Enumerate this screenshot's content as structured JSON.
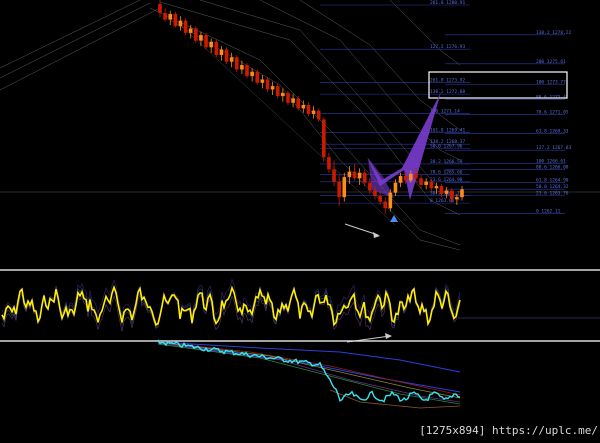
{
  "watermark": "[1275x894] https://uplc.me/",
  "colors": {
    "background": "#000000",
    "bull_candle": "#ff8c1a",
    "bear_candle": "#cc1a00",
    "fib_line": "#2b3aa8",
    "fib_text": "#5a6fd8",
    "envelope": "#8f8f8f",
    "pattern_fill": "#7a3ccf",
    "oscillator": "#ffee00",
    "divider": "#d9d9d9",
    "cyan_line": "#33e6f2",
    "arrow": "#4d8cff"
  },
  "chart_data": {
    "type": "line",
    "title": "",
    "price_range": [
      1261,
      1281
    ],
    "fib_levels": [
      {
        "label": "261.8 1280.91",
        "price": 1280.91
      },
      {
        "label": "138.2 1278.22",
        "price": 1278.22
      },
      {
        "label": "127.2 1276.93",
        "price": 1276.93
      },
      {
        "label": "200 1275.61",
        "price": 1275.61
      },
      {
        "label": "261.8 1273.92",
        "price": 1273.92
      },
      {
        "label": "100 1273.77",
        "price": 1273.77
      },
      {
        "label": "138.2 1272.88",
        "price": 1272.88
      },
      {
        "label": "88.6 1272.41",
        "price": 1272.41
      },
      {
        "label": "100 1271.14",
        "price": 1271.14
      },
      {
        "label": "78.6 1271.05",
        "price": 1271.05
      },
      {
        "label": "161.8 1269.41",
        "price": 1269.41
      },
      {
        "label": "61.8 1269.33",
        "price": 1269.33
      },
      {
        "label": "138.2 1268.37",
        "price": 1268.37
      },
      {
        "label": "127.2 1267.83",
        "price": 1267.83
      },
      {
        "label": "50.0 1267.96",
        "price": 1267.96
      },
      {
        "label": "100 1266.61",
        "price": 1266.61
      },
      {
        "label": "38.2 1266.59",
        "price": 1266.59
      },
      {
        "label": "88.6 1266.08",
        "price": 1266.08
      },
      {
        "label": "78.6 1265.66",
        "price": 1265.66
      },
      {
        "label": "61.8 1264.90",
        "price": 1264.9
      },
      {
        "label": "23.6 1264.98",
        "price": 1264.98
      },
      {
        "label": "50.0 1264.32",
        "price": 1264.32
      },
      {
        "label": "38.2 1263.74",
        "price": 1263.74
      },
      {
        "label": "23.6 1263.76",
        "price": 1263.76
      },
      {
        "label": "0 1263.06",
        "price": 1263.06
      },
      {
        "label": "0 1262.11",
        "price": 1262.11
      }
    ],
    "candles": [
      [
        1281.0,
        1281.5,
        1279.8,
        1280.2
      ],
      [
        1280.2,
        1280.6,
        1279.4,
        1279.6
      ],
      [
        1279.6,
        1280.4,
        1279.1,
        1280.1
      ],
      [
        1280.1,
        1280.3,
        1278.9,
        1279.0
      ],
      [
        1279.0,
        1279.9,
        1278.6,
        1279.5
      ],
      [
        1279.5,
        1279.7,
        1278.2,
        1278.4
      ],
      [
        1278.4,
        1279.1,
        1277.9,
        1278.8
      ],
      [
        1278.8,
        1279.0,
        1277.5,
        1277.7
      ],
      [
        1277.7,
        1278.5,
        1277.2,
        1278.2
      ],
      [
        1278.2,
        1278.4,
        1276.9,
        1277.1
      ],
      [
        1277.1,
        1277.9,
        1276.6,
        1277.6
      ],
      [
        1277.6,
        1277.8,
        1276.2,
        1276.4
      ],
      [
        1276.4,
        1277.2,
        1275.9,
        1276.9
      ],
      [
        1276.9,
        1277.1,
        1275.6,
        1275.8
      ],
      [
        1275.8,
        1276.6,
        1275.3,
        1276.2
      ],
      [
        1276.2,
        1276.4,
        1274.9,
        1275.1
      ],
      [
        1275.1,
        1275.9,
        1274.7,
        1275.5
      ],
      [
        1275.5,
        1275.7,
        1274.3,
        1274.5
      ],
      [
        1274.5,
        1275.2,
        1274.0,
        1274.9
      ],
      [
        1274.9,
        1275.1,
        1273.7,
        1273.9
      ],
      [
        1273.9,
        1274.6,
        1273.4,
        1274.2
      ],
      [
        1274.2,
        1274.4,
        1273.1,
        1273.3
      ],
      [
        1273.3,
        1274.0,
        1272.8,
        1273.6
      ],
      [
        1273.6,
        1273.8,
        1272.5,
        1272.7
      ],
      [
        1272.7,
        1273.4,
        1272.2,
        1273.0
      ],
      [
        1273.0,
        1273.2,
        1271.9,
        1272.1
      ],
      [
        1272.1,
        1272.9,
        1271.7,
        1272.5
      ],
      [
        1272.5,
        1272.7,
        1271.4,
        1271.6
      ],
      [
        1271.6,
        1272.3,
        1271.2,
        1271.9
      ],
      [
        1271.9,
        1272.1,
        1270.9,
        1271.1
      ],
      [
        1271.1,
        1271.8,
        1270.7,
        1271.4
      ],
      [
        1271.4,
        1271.6,
        1270.4,
        1270.6
      ],
      [
        1270.6,
        1270.8,
        1266.8,
        1267.2
      ],
      [
        1267.2,
        1267.6,
        1265.8,
        1266.1
      ],
      [
        1266.1,
        1266.9,
        1264.6,
        1265.0
      ],
      [
        1265.0,
        1265.6,
        1262.8,
        1263.6
      ],
      [
        1263.6,
        1265.8,
        1263.2,
        1265.4
      ],
      [
        1265.4,
        1266.4,
        1264.8,
        1265.9
      ],
      [
        1265.9,
        1266.6,
        1265.1,
        1265.3
      ],
      [
        1265.3,
        1266.2,
        1264.7,
        1265.8
      ],
      [
        1265.8,
        1266.1,
        1264.6,
        1264.9
      ],
      [
        1264.9,
        1265.3,
        1263.9,
        1264.2
      ],
      [
        1264.2,
        1264.6,
        1263.4,
        1263.7
      ],
      [
        1263.7,
        1264.1,
        1262.9,
        1263.2
      ],
      [
        1263.2,
        1263.6,
        1262.1,
        1262.6
      ],
      [
        1262.6,
        1264.3,
        1262.3,
        1264.0
      ],
      [
        1264.0,
        1265.2,
        1263.7,
        1264.9
      ],
      [
        1264.9,
        1265.8,
        1264.5,
        1265.5
      ],
      [
        1265.5,
        1265.9,
        1264.8,
        1265.1
      ],
      [
        1265.1,
        1266.0,
        1264.9,
        1265.7
      ],
      [
        1265.7,
        1266.2,
        1265.0,
        1265.3
      ],
      [
        1265.3,
        1265.6,
        1264.4,
        1264.7
      ],
      [
        1264.7,
        1265.3,
        1264.3,
        1265.0
      ],
      [
        1265.0,
        1265.2,
        1264.1,
        1264.4
      ],
      [
        1264.4,
        1264.9,
        1263.9,
        1264.6
      ],
      [
        1264.6,
        1264.8,
        1263.6,
        1263.9
      ],
      [
        1263.9,
        1264.5,
        1263.5,
        1264.2
      ],
      [
        1264.2,
        1264.4,
        1263.1,
        1263.4
      ],
      [
        1263.4,
        1263.9,
        1262.9,
        1263.6
      ],
      [
        1263.6,
        1264.6,
        1263.3,
        1264.3
      ]
    ]
  }
}
